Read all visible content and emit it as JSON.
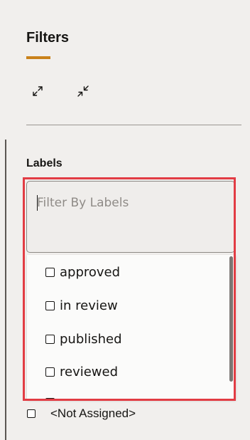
{
  "panel": {
    "title": "Filters",
    "accent_color": "#c9821b",
    "toolbar": {
      "expand_icon": "expand-arrows-icon",
      "collapse_icon": "collapse-arrows-icon"
    }
  },
  "labels_section": {
    "heading": "Labels",
    "search": {
      "placeholder": "Filter By Labels",
      "value": ""
    },
    "options": [
      {
        "label": "approved",
        "checked": false
      },
      {
        "label": "in review",
        "checked": false
      },
      {
        "label": "published",
        "checked": false
      },
      {
        "label": "reviewed",
        "checked": false
      },
      {
        "label": "",
        "checked": false
      }
    ],
    "not_assigned": {
      "label": "<Not Assigned>",
      "checked": false
    }
  },
  "highlight_color": "#e23c44"
}
